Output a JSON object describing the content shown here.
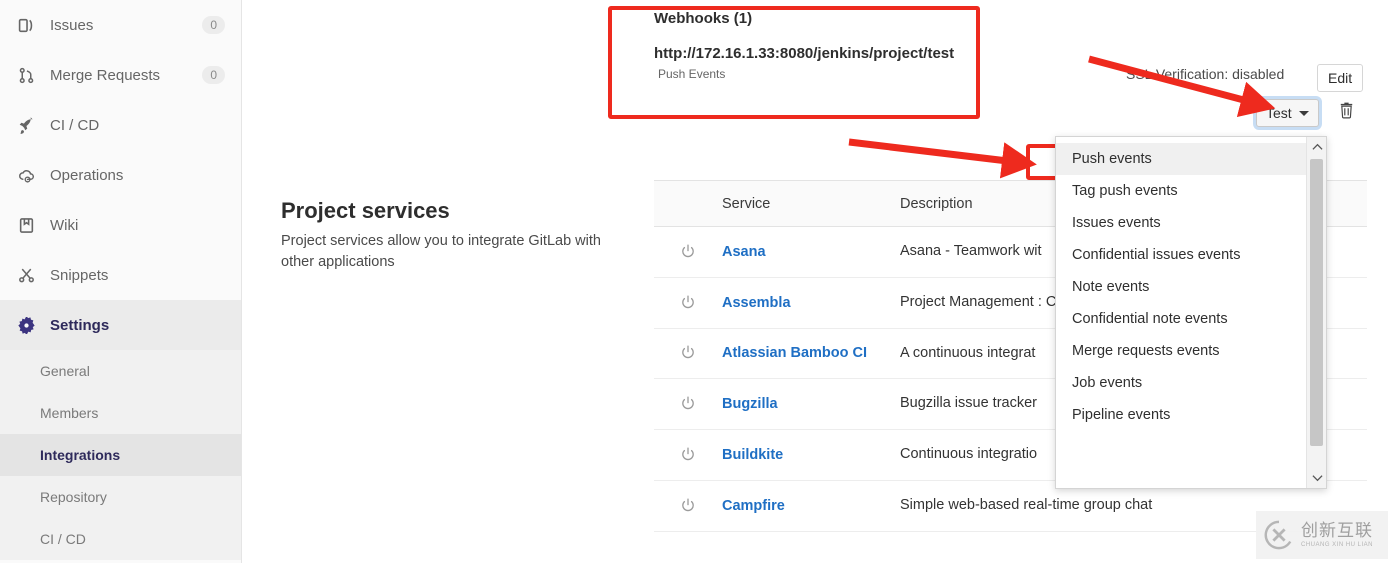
{
  "sidebar": {
    "items": [
      {
        "label": "Issues",
        "icon": "issues-icon",
        "badge": "0"
      },
      {
        "label": "Merge Requests",
        "icon": "merge-request-icon",
        "badge": "0"
      },
      {
        "label": "CI / CD",
        "icon": "rocket-icon",
        "badge": ""
      },
      {
        "label": "Operations",
        "icon": "cloud-gear-icon",
        "badge": ""
      },
      {
        "label": "Wiki",
        "icon": "book-icon",
        "badge": ""
      },
      {
        "label": "Snippets",
        "icon": "scissors-icon",
        "badge": ""
      },
      {
        "label": "Settings",
        "icon": "gear-icon",
        "badge": ""
      }
    ],
    "settings_children": [
      {
        "label": "General"
      },
      {
        "label": "Members"
      },
      {
        "label": "Integrations"
      },
      {
        "label": "Repository"
      },
      {
        "label": "CI / CD"
      }
    ],
    "active_item": "Settings",
    "current_child": "Integrations"
  },
  "webhooks": {
    "title": "Webhooks (1)",
    "url": "http://172.16.1.33:8080/jenkins/project/test",
    "events_label": "Push Events"
  },
  "actions": {
    "ssl_status": "SSL Verification: disabled",
    "edit_label": "Edit",
    "test_label": "Test",
    "delete_icon": "trash-icon"
  },
  "project_services": {
    "heading": "Project services",
    "description": "Project services allow you to integrate GitLab with other applications"
  },
  "services_table": {
    "columns": [
      "",
      "Service",
      "Description"
    ],
    "rows": [
      {
        "icon": "power-icon",
        "name": "Asana",
        "description": "Asana - Teamwork wit"
      },
      {
        "icon": "power-icon",
        "name": "Assembla",
        "description": "Project Management : Commits Endpoint)"
      },
      {
        "icon": "power-icon",
        "name": "Atlassian Bamboo CI",
        "description": "A continuous integrat"
      },
      {
        "icon": "power-icon",
        "name": "Bugzilla",
        "description": "Bugzilla issue tracker"
      },
      {
        "icon": "power-icon",
        "name": "Buildkite",
        "description": "Continuous integratio"
      },
      {
        "icon": "power-icon",
        "name": "Campfire",
        "description": "Simple web-based real-time group chat"
      }
    ]
  },
  "events_dropdown": {
    "items": [
      "Push events",
      "Tag push events",
      "Issues events",
      "Confidential issues events",
      "Note events",
      "Confidential note events",
      "Merge requests events",
      "Job events",
      "Pipeline events"
    ],
    "highlighted": "Push events",
    "scroll_up_icon": "chevron-up-icon",
    "scroll_down_icon": "chevron-down-icon"
  },
  "annotations": {
    "accent_color": "#ee2a1e",
    "box_webhooks": "red-highlight-box-webhooks",
    "box_push_events": "red-highlight-box-push-events",
    "arrow_to_test": "red-arrow-to-test-button",
    "arrow_to_push_events": "red-arrow-to-push-events"
  },
  "watermark": {
    "cn": "创新互联",
    "en": "CHUANG XIN HU LIAN",
    "logo": "cx-logo-icon"
  }
}
